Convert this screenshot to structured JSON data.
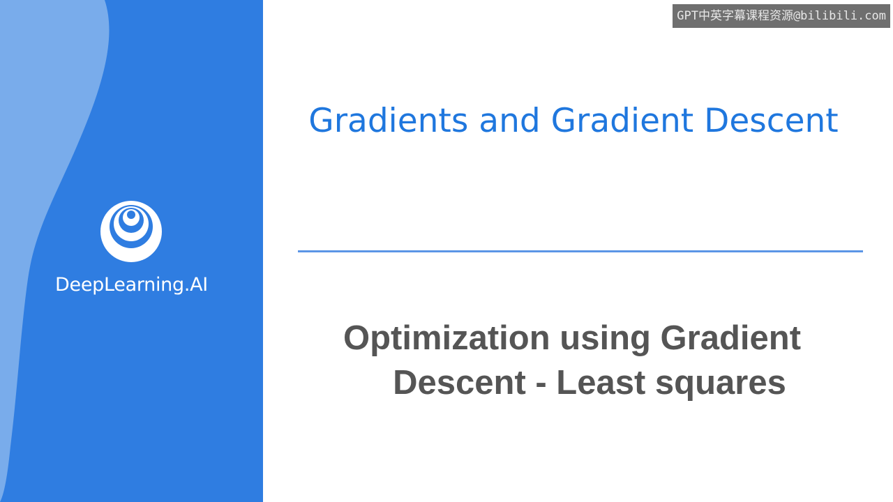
{
  "sidebar": {
    "brand_name": "DeepLearning.AI",
    "colors": {
      "background": "#2f7de1",
      "wave": "#86b4ec",
      "logo": "#ffffff"
    },
    "logo_icon": "concentric-circles-logo-icon"
  },
  "watermark": {
    "text": "GPT中英字幕课程资源@bilibili.com"
  },
  "slide": {
    "title": "Gradients and Gradient Descent",
    "title_color": "#1f77de",
    "divider_color": "#5b95e6",
    "subtitle_line1": "Optimization using Gradient",
    "subtitle_line2": "Descent - Least squares",
    "subtitle_color": "#555555"
  }
}
